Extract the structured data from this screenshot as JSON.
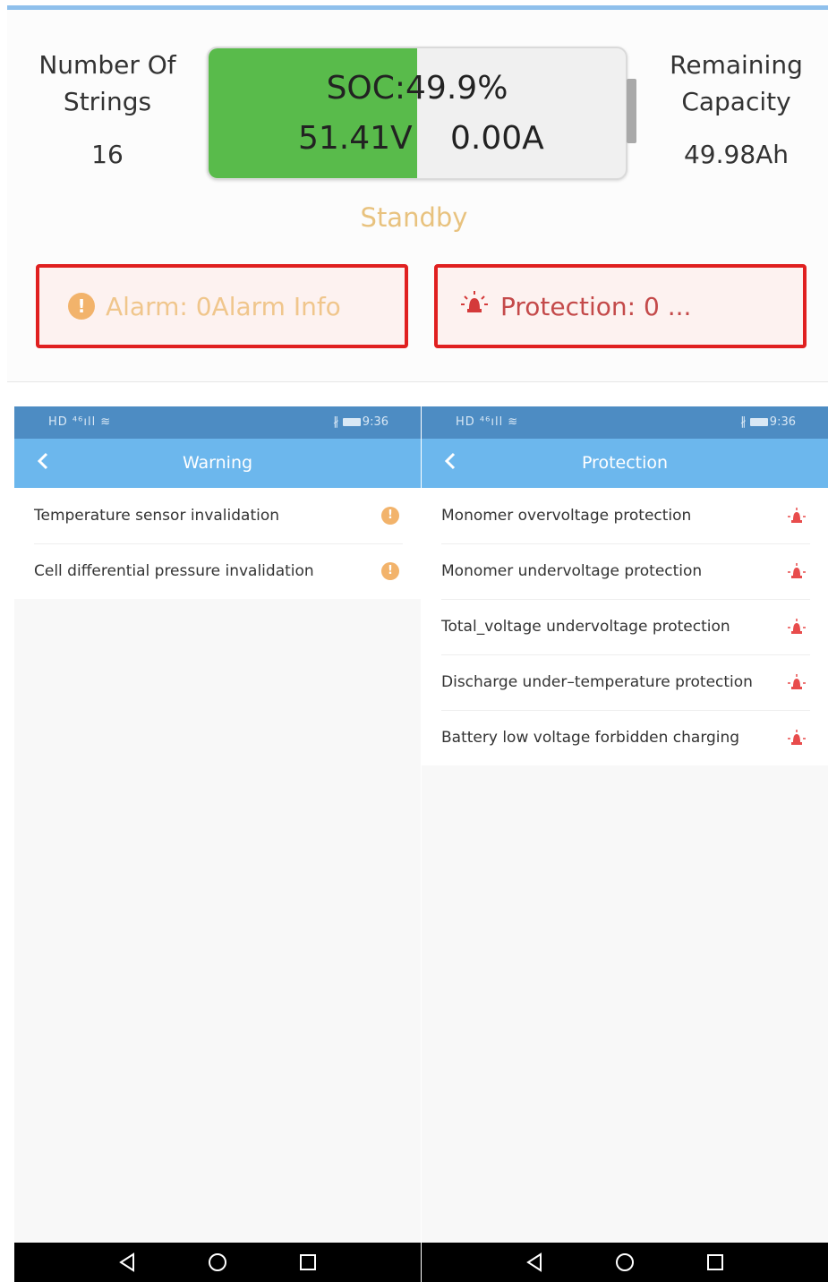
{
  "dashboard": {
    "strings_label_line1": "Number Of",
    "strings_label_line2": "Strings",
    "strings_value": "16",
    "capacity_label_line1": "Remaining",
    "capacity_label_line2": "Capacity",
    "capacity_value": "49.98Ah",
    "soc_text": "SOC:49.9%",
    "soc_fraction": 0.499,
    "voltage": "51.41V",
    "current": "0.00A",
    "status": "Standby",
    "alarm_text": "Alarm: 0Alarm Info",
    "protection_text": "Protection: 0 ...",
    "colors": {
      "battery_fill": "#59bb4b",
      "status": "#e8c27e",
      "alert_border": "#e02020",
      "alarm_text": "#f0c68c",
      "protection_text": "#c44a4a"
    }
  },
  "status_bar": {
    "left_icons": "HD ⁴⁶ıll ≋",
    "bluetooth": "∦",
    "time": "9:36"
  },
  "warning_screen": {
    "title": "Warning",
    "items": [
      {
        "label": "Temperature sensor invalidation",
        "icon": "warning-icon"
      },
      {
        "label": "Cell differential pressure invalidation",
        "icon": "warning-icon"
      }
    ]
  },
  "protection_screen": {
    "title": "Protection",
    "items": [
      {
        "label": "Monomer overvoltage protection",
        "icon": "alarm-light-icon"
      },
      {
        "label": "Monomer undervoltage protection",
        "icon": "alarm-light-icon"
      },
      {
        "label": "Total_voltage undervoltage protection",
        "icon": "alarm-light-icon"
      },
      {
        "label": "Discharge under–temperature protection",
        "icon": "alarm-light-icon"
      },
      {
        "label": "Battery low voltage forbidden charging",
        "icon": "alarm-light-icon"
      }
    ]
  },
  "theme": {
    "status_bar": "#4d8cc3",
    "nav_bar": "#6cb7ed",
    "warning_icon": "#f2b36b",
    "protection_icon": "#e84c4c"
  }
}
